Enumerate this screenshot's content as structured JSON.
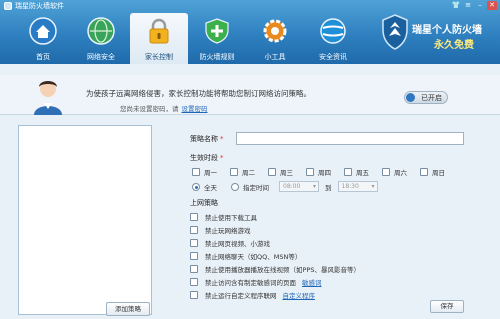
{
  "app": {
    "title": "瑞星防火墙软件"
  },
  "nav": [
    {
      "label": "首页",
      "icon": "home-icon"
    },
    {
      "label": "网络安全",
      "icon": "globe-shield-icon"
    },
    {
      "label": "家长控制",
      "icon": "lock-icon"
    },
    {
      "label": "防火墙规则",
      "icon": "shield-icon"
    },
    {
      "label": "小工具",
      "icon": "gear-icon"
    },
    {
      "label": "安全资讯",
      "icon": "world-icon"
    }
  ],
  "promo": {
    "line1": "瑞星个人防火墙",
    "line2": "永久免费"
  },
  "banner": {
    "message": "为使孩子远离网络侵害，家长控制功能将帮助您制订网络访问策略。",
    "sub": "您尚未设置密码，请",
    "link": "设置密码",
    "toggle_label": "已开启"
  },
  "left_pane": {
    "add_button": "添加策略"
  },
  "form": {
    "policy_name_label": "策略名称",
    "effective_period_label": "生效时段",
    "days": [
      "周一",
      "周二",
      "周三",
      "周四",
      "周五",
      "周六",
      "周日"
    ],
    "all_day_label": "全天",
    "specified_time_label": "指定时间",
    "time_start": "08:00",
    "time_to": "到",
    "time_end": "18:30",
    "internet_policy_label": "上网策略",
    "rules": [
      {
        "label": "禁止使用下载工具"
      },
      {
        "label": "禁止玩网络游戏"
      },
      {
        "label": "禁止网页视频、小游戏"
      },
      {
        "label": "禁止网络聊天（如QQ、MSN等）"
      },
      {
        "label": "禁止使用播放器播放在线视频（如PPS、暴风影音等）"
      },
      {
        "label": "禁止访问含有制定敏感词的页面",
        "link": "敏感词"
      },
      {
        "label": "禁止运行自定义程序联网",
        "link": "自定义程序"
      }
    ],
    "save_label": "保存"
  },
  "colors": {
    "header": "#2f80c0",
    "accent": "#1e66b8",
    "required": "#dd3333"
  }
}
